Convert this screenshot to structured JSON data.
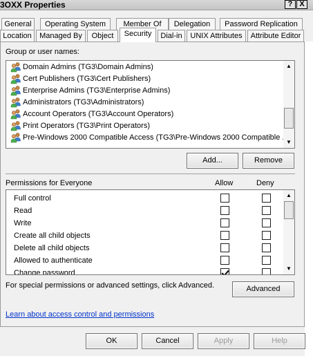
{
  "window": {
    "title": "3OXX Properties",
    "help_glyph": "?",
    "close_glyph": "X"
  },
  "tabs_row1": [
    {
      "label": "General"
    },
    {
      "label": "Operating System"
    },
    {
      "label": "Member Of"
    },
    {
      "label": "Delegation"
    },
    {
      "label": "Password Replication"
    }
  ],
  "tabs_row2": [
    {
      "label": "Location"
    },
    {
      "label": "Managed By"
    },
    {
      "label": "Object"
    },
    {
      "label": "Security",
      "active": true
    },
    {
      "label": "Dial-in"
    },
    {
      "label": "UNIX Attributes"
    },
    {
      "label": "Attribute Editor"
    }
  ],
  "groups": {
    "label": "Group or user names:",
    "items": [
      {
        "text": "Domain Admins (TG3\\Domain Admins)",
        "icon": "user-group-icon"
      },
      {
        "text": "Cert Publishers (TG3\\Cert Publishers)",
        "icon": "user-group-icon"
      },
      {
        "text": "Enterprise Admins (TG3\\Enterprise Admins)",
        "icon": "user-group-icon"
      },
      {
        "text": "Administrators (TG3\\Administrators)",
        "icon": "user-group-icon"
      },
      {
        "text": "Account Operators (TG3\\Account Operators)",
        "icon": "user-group-icon"
      },
      {
        "text": "Print Operators (TG3\\Print Operators)",
        "icon": "user-group-icon"
      },
      {
        "text": "Pre-Windows 2000 Compatible Access (TG3\\Pre-Windows 2000 Compatible ...",
        "icon": "user-group-icon"
      }
    ],
    "add_label": "Add...",
    "remove_label": "Remove"
  },
  "permissions": {
    "label": "Permissions for Everyone",
    "allow_header": "Allow",
    "deny_header": "Deny",
    "items": [
      {
        "name": "Full control",
        "allow": false,
        "deny": false
      },
      {
        "name": "Read",
        "allow": false,
        "deny": false
      },
      {
        "name": "Write",
        "allow": false,
        "deny": false
      },
      {
        "name": "Create all child objects",
        "allow": false,
        "deny": false
      },
      {
        "name": "Delete all child objects",
        "allow": false,
        "deny": false
      },
      {
        "name": "Allowed to authenticate",
        "allow": false,
        "deny": false
      },
      {
        "name": "Change password",
        "allow": true,
        "deny": false
      }
    ]
  },
  "advanced": {
    "hint": "For special permissions or advanced settings, click Advanced.",
    "button_label": "Advanced"
  },
  "learn_link": "Learn about access control and permissions",
  "footer": {
    "ok_label": "OK",
    "cancel_label": "Cancel",
    "apply_label": "Apply",
    "help_label": "Help"
  },
  "colors": {
    "link": "#0033cc",
    "panel": "#f0f0f0"
  }
}
